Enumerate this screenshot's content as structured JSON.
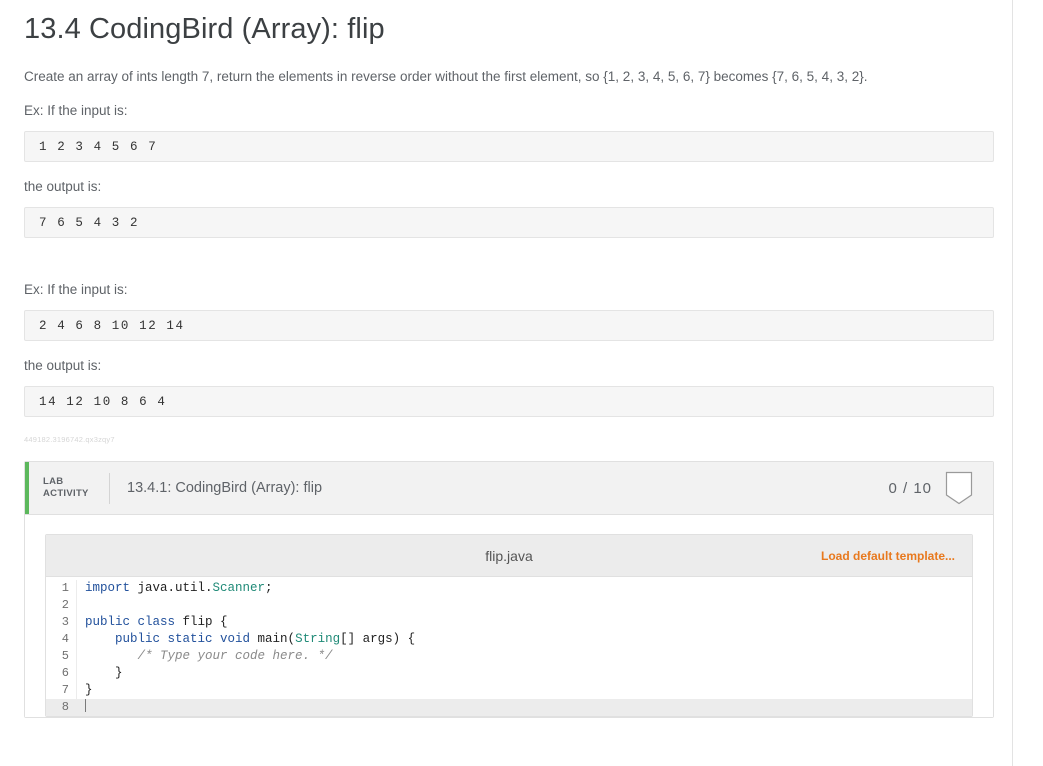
{
  "page": {
    "title": "13.4 CodingBird (Array): flip",
    "description": "Create an array of ints length 7, return the elements in reverse order without the first element, so {1, 2, 3, 4, 5, 6, 7} becomes {7, 6, 5, 4, 3, 2}.",
    "stamp": "449182.3196742.qx3zqy7"
  },
  "examples": [
    {
      "input_label": "Ex: If the input is:",
      "input_value": "1 2 3 4 5 6 7",
      "output_label": "the output is:",
      "output_value": "7 6 5 4 3 2"
    },
    {
      "input_label": "Ex: If the input is:",
      "input_value": "2 4 6 8 10 12 14",
      "output_label": "the output is:",
      "output_value": "14 12 10 8 6 4"
    }
  ],
  "lab": {
    "tag_line1": "LAB",
    "tag_line2": "ACTIVITY",
    "title": "13.4.1: CodingBird (Array): flip",
    "score": "0 / 10",
    "score_earned": 0,
    "score_total": 10,
    "accent_color": "#5cb85c"
  },
  "editor": {
    "filename": "flip.java",
    "load_default_label": "Load default template...",
    "link_color": "#e8791e",
    "active_line": 8,
    "lines": [
      {
        "n": "1",
        "tokens": [
          {
            "t": "import ",
            "c": "kw"
          },
          {
            "t": "java.util.",
            "c": ""
          },
          {
            "t": "Scanner",
            "c": "type"
          },
          {
            "t": ";",
            "c": ""
          }
        ]
      },
      {
        "n": "2",
        "tokens": []
      },
      {
        "n": "3",
        "tokens": [
          {
            "t": "public class ",
            "c": "kw"
          },
          {
            "t": "flip",
            "c": ""
          },
          {
            "t": " {",
            "c": ""
          }
        ]
      },
      {
        "n": "4",
        "tokens": [
          {
            "t": "    ",
            "c": ""
          },
          {
            "t": "public static void ",
            "c": "kw"
          },
          {
            "t": "main(",
            "c": ""
          },
          {
            "t": "String",
            "c": "type"
          },
          {
            "t": "[] args) {",
            "c": ""
          }
        ]
      },
      {
        "n": "5",
        "tokens": [
          {
            "t": "       ",
            "c": ""
          },
          {
            "t": "/* Type your code here. */",
            "c": "cmt"
          }
        ]
      },
      {
        "n": "6",
        "tokens": [
          {
            "t": "    }",
            "c": ""
          }
        ]
      },
      {
        "n": "7",
        "tokens": [
          {
            "t": "}",
            "c": ""
          }
        ]
      },
      {
        "n": "8",
        "tokens": []
      }
    ]
  }
}
